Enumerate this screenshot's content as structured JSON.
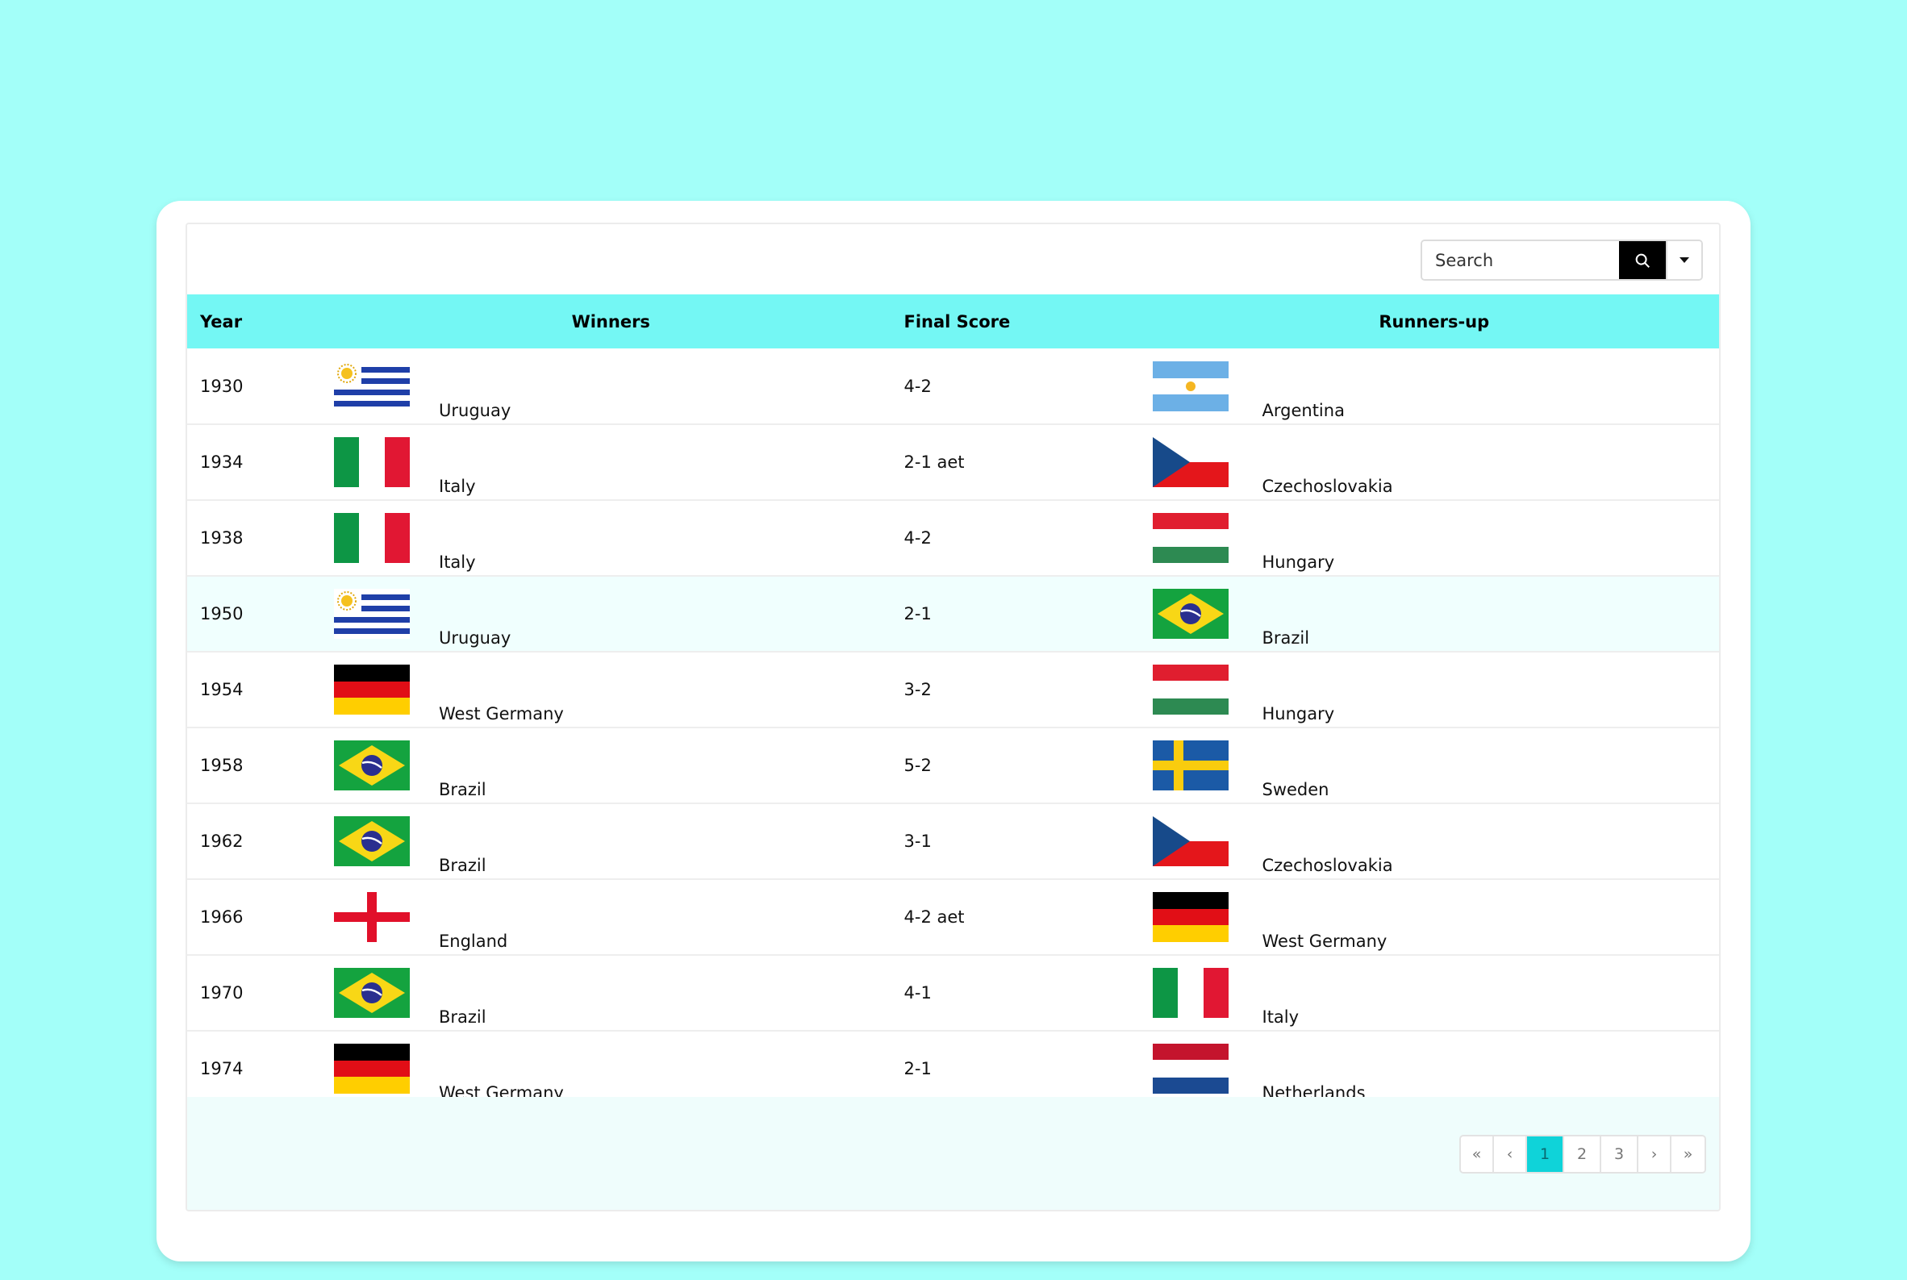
{
  "search": {
    "placeholder": "Search"
  },
  "table": {
    "headers": {
      "year": "Year",
      "winners": "Winners",
      "score": "Final Score",
      "runners": "Runners-up"
    },
    "rows": [
      {
        "year": "1930",
        "winner": "Uruguay",
        "winner_flag": "uruguay-flag",
        "score": "4-2",
        "runner": "Argentina",
        "runner_flag": "argentina-flag"
      },
      {
        "year": "1934",
        "winner": "Italy",
        "winner_flag": "italy-flag",
        "score": "2-1 aet",
        "runner": "Czechoslovakia",
        "runner_flag": "czechoslovakia-flag"
      },
      {
        "year": "1938",
        "winner": "Italy",
        "winner_flag": "italy-flag",
        "score": "4-2",
        "runner": "Hungary",
        "runner_flag": "hungary-flag"
      },
      {
        "year": "1950",
        "winner": "Uruguay",
        "winner_flag": "uruguay-flag",
        "score": "2-1",
        "runner": "Brazil",
        "runner_flag": "brazil-flag"
      },
      {
        "year": "1954",
        "winner": "West Germany",
        "winner_flag": "germany-flag",
        "score": "3-2",
        "runner": "Hungary",
        "runner_flag": "hungary-flag"
      },
      {
        "year": "1958",
        "winner": "Brazil",
        "winner_flag": "brazil-flag",
        "score": "5-2",
        "runner": "Sweden",
        "runner_flag": "sweden-flag"
      },
      {
        "year": "1962",
        "winner": "Brazil",
        "winner_flag": "brazil-flag",
        "score": "3-1",
        "runner": "Czechoslovakia",
        "runner_flag": "czechoslovakia-flag"
      },
      {
        "year": "1966",
        "winner": "England",
        "winner_flag": "england-flag",
        "score": "4-2 aet",
        "runner": "West Germany",
        "runner_flag": "germany-flag"
      },
      {
        "year": "1970",
        "winner": "Brazil",
        "winner_flag": "brazil-flag",
        "score": "4-1",
        "runner": "Italy",
        "runner_flag": "italy-flag"
      },
      {
        "year": "1974",
        "winner": "West Germany",
        "winner_flag": "germany-flag",
        "score": "2-1",
        "runner": "Netherlands",
        "runner_flag": "netherlands-flag"
      }
    ]
  },
  "pagination": {
    "first": "«",
    "prev": "‹",
    "pages": [
      "1",
      "2",
      "3"
    ],
    "active_page": "1",
    "next": "›",
    "last": "»"
  },
  "colors": {
    "background": "#a3fff9",
    "header": "#74f7f4",
    "accent": "#0fd3d9",
    "highlight_row": "#f0fffe"
  }
}
